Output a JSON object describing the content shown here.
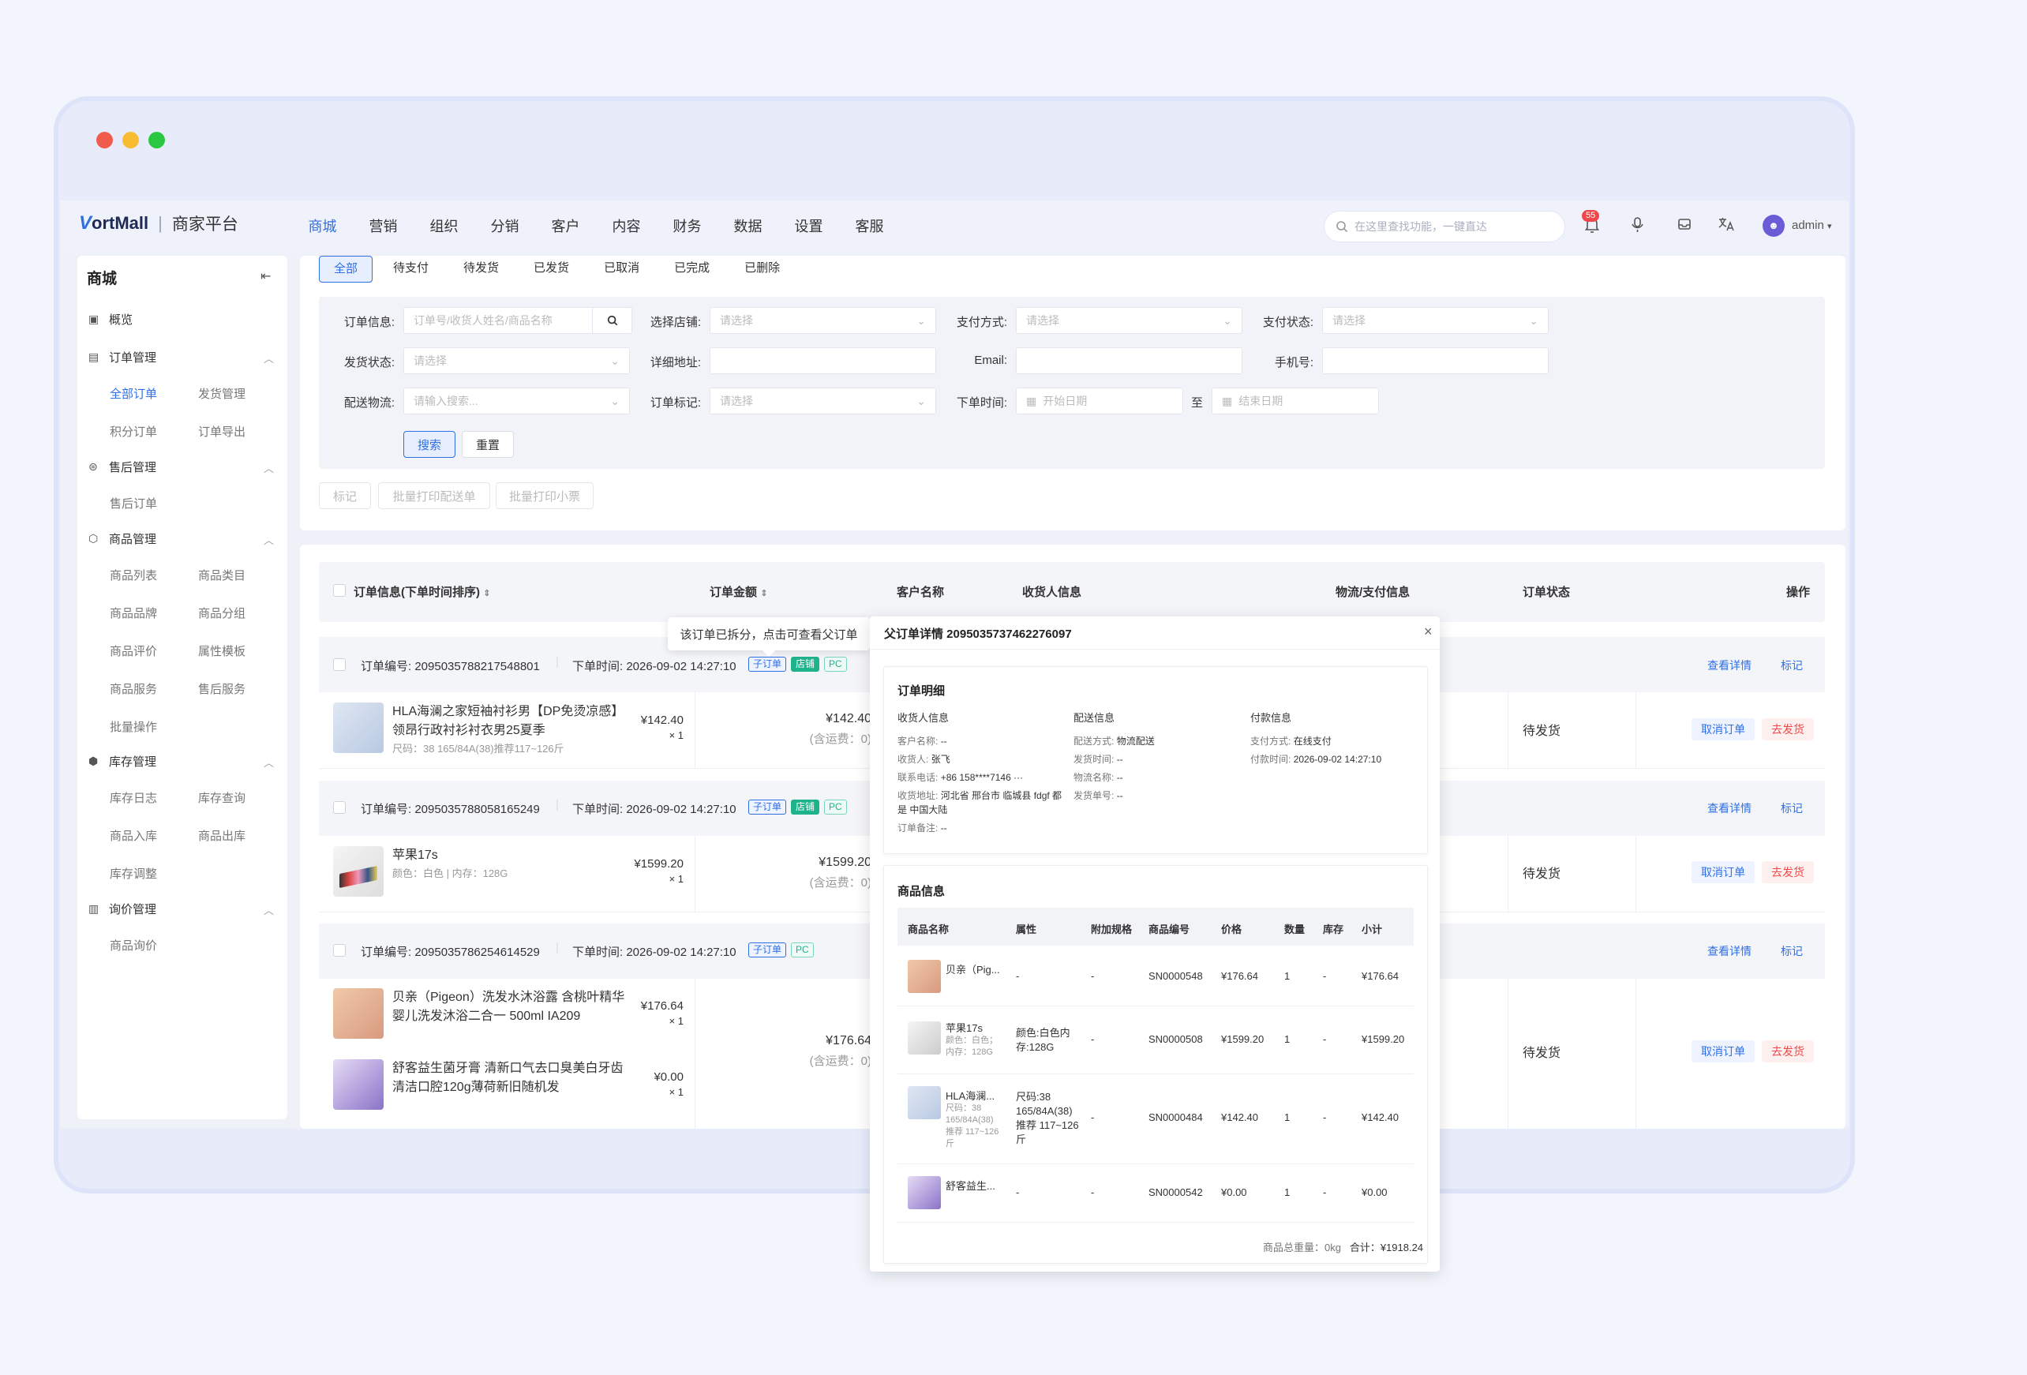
{
  "app": {
    "brand": "ortMall",
    "brand_mark": "V",
    "subtitle": "商家平台"
  },
  "colors": {
    "accent": "#2f6fe4",
    "danger": "#f04848",
    "success": "#1db38b"
  },
  "nav": [
    {
      "label": "商城"
    },
    {
      "label": "营销"
    },
    {
      "label": "组织"
    },
    {
      "label": "分销"
    },
    {
      "label": "客户"
    },
    {
      "label": "内容"
    },
    {
      "label": "财务"
    },
    {
      "label": "数据"
    },
    {
      "label": "设置"
    },
    {
      "label": "客服"
    }
  ],
  "search": {
    "placeholder": "在这里查找功能，一键直达"
  },
  "notifications": {
    "count": "55"
  },
  "user": {
    "name": "admin"
  },
  "sidebar": {
    "title": "商城",
    "overview": "概览",
    "groups": [
      {
        "label": "订单管理",
        "links": [
          "全部订单",
          "发货管理",
          "积分订单",
          "订单导出"
        ]
      },
      {
        "label": "售后管理",
        "links": [
          "售后订单"
        ]
      },
      {
        "label": "商品管理",
        "links": [
          "商品列表",
          "商品类目",
          "商品品牌",
          "商品分组",
          "商品评价",
          "属性模板",
          "商品服务",
          "售后服务",
          "批量操作"
        ]
      },
      {
        "label": "库存管理",
        "links": [
          "库存日志",
          "库存查询",
          "商品入库",
          "商品出库",
          "库存调整"
        ]
      },
      {
        "label": "询价管理",
        "links": [
          "商品询价"
        ]
      }
    ]
  },
  "tabs": [
    "全部",
    "待支付",
    "待发货",
    "已发货",
    "已取消",
    "已完成",
    "已删除"
  ],
  "filters": {
    "order_info": {
      "label": "订单信息:",
      "placeholder": "订单号/收货人姓名/商品名称"
    },
    "shop": {
      "label": "选择店铺:",
      "placeholder": "请选择"
    },
    "pay_method": {
      "label": "支付方式:",
      "placeholder": "请选择"
    },
    "pay_status": {
      "label": "支付状态:",
      "placeholder": "请选择"
    },
    "ship_status": {
      "label": "发货状态:",
      "placeholder": "请选择"
    },
    "address": {
      "label": "详细地址:",
      "placeholder": ""
    },
    "email": {
      "label": "Email:",
      "placeholder": ""
    },
    "phone": {
      "label": "手机号:",
      "placeholder": ""
    },
    "logistics": {
      "label": "配送物流:",
      "placeholder": "请输入搜索..."
    },
    "mark": {
      "label": "订单标记:",
      "placeholder": "请选择"
    },
    "time": {
      "label": "下单时间:",
      "start": "开始日期",
      "to": "至",
      "end": "结束日期"
    },
    "search_btn": "搜索",
    "reset_btn": "重置"
  },
  "bulk": [
    "标记",
    "批量打印配送单",
    "批量打印小票"
  ],
  "table": {
    "headers": {
      "info": "订单信息(下单时间排序)",
      "amount": "订单金额",
      "customer": "客户名称",
      "receiver": "收货人信息",
      "logistics": "物流/支付信息",
      "status": "订单状态",
      "action": "操作"
    }
  },
  "orders": [
    {
      "no_label": "订单编号:",
      "no": "2095035788217548801",
      "time_label": "下单时间:",
      "time": "2026-09-02 14:27:10",
      "tags": [
        "子订单",
        "店铺",
        "PC"
      ],
      "items": [
        {
          "name": "HLA海澜之家短袖衬衫男【DP免烫凉感】领昂行政衬衫衬衣男25夏季",
          "spec": "尺码：38 165/84A(38)推荐117~126斤",
          "price": "¥142.40",
          "qty": "× 1"
        }
      ],
      "total": "¥142.40",
      "freight": "(含运费：0)",
      "status": "待发货",
      "actions": {
        "detail": "查看详情",
        "mark": "标记",
        "cancel": "取消订单",
        "ship": "去发货"
      }
    },
    {
      "no_label": "订单编号:",
      "no": "2095035788058165249",
      "time_label": "下单时间:",
      "time": "2026-09-02 14:27:10",
      "tags": [
        "子订单",
        "店铺",
        "PC"
      ],
      "items": [
        {
          "name": "苹果17s",
          "spec": "颜色：白色 | 内存：128G",
          "price": "¥1599.20",
          "qty": "× 1"
        }
      ],
      "total": "¥1599.20",
      "freight": "(含运费：0)",
      "status": "待发货",
      "actions": {
        "detail": "查看详情",
        "mark": "标记",
        "cancel": "取消订单",
        "ship": "去发货"
      }
    },
    {
      "no_label": "订单编号:",
      "no": "2095035786254614529",
      "time_label": "下单时间:",
      "time": "2026-09-02 14:27:10",
      "tags": [
        "子订单",
        "PC"
      ],
      "items": [
        {
          "name": "贝亲（Pigeon）洗发水沐浴露 含桃叶精华 婴儿洗发沐浴二合一 500ml IA209",
          "spec": "",
          "price": "¥176.64",
          "qty": "× 1"
        },
        {
          "name": "舒客益生菌牙膏 清新口气去口臭美白牙齿清洁口腔120g薄荷新旧随机发",
          "spec": "",
          "price": "¥0.00",
          "qty": "× 1"
        }
      ],
      "total": "¥176.64",
      "freight": "(含运费：0)",
      "status": "待发货",
      "actions": {
        "detail": "查看详情",
        "mark": "标记",
        "cancel": "取消订单",
        "ship": "去发货"
      }
    }
  ],
  "tooltip": "该订单已拆分，点击可查看父订单",
  "popup": {
    "title": "父订单详情 2095035737462276097",
    "detail_title": "订单明细",
    "receiver": {
      "title": "收货人信息",
      "rows": [
        {
          "k": "客户名称:",
          "v": "--"
        },
        {
          "k": "收货人:",
          "v": "张飞"
        },
        {
          "k": "联系电话:",
          "v": "+86  158****7146  ···"
        },
        {
          "k": "收货地址:",
          "v": "河北省 邢台市 临城县 fdgf 都是 中国大陆"
        },
        {
          "k": "订单备注:",
          "v": "--"
        }
      ]
    },
    "delivery": {
      "title": "配送信息",
      "rows": [
        {
          "k": "配送方式:",
          "v": "物流配送"
        },
        {
          "k": "发货时间:",
          "v": "--"
        },
        {
          "k": "物流名称:",
          "v": "--"
        },
        {
          "k": "发货单号:",
          "v": "--"
        }
      ]
    },
    "payment": {
      "title": "付款信息",
      "rows": [
        {
          "k": "支付方式:",
          "v": "在线支付"
        },
        {
          "k": "付款时间:",
          "v": "2026-09-02 14:27:10"
        }
      ]
    },
    "goods_title": "商品信息",
    "goods_headers": [
      "商品名称",
      "属性",
      "附加规格",
      "商品编号",
      "价格",
      "数量",
      "库存",
      "小计"
    ],
    "goods": [
      {
        "name": "贝亲（Pig...",
        "sub": "",
        "attr": "-",
        "extra": "-",
        "sn": "SN0000548",
        "price": "¥176.64",
        "qty": "1",
        "stock": "-",
        "subtotal": "¥176.64"
      },
      {
        "name": "苹果17s",
        "sub": "颜色：白色；内存：128G",
        "attr": "颜色:白色内存:128G",
        "extra": "-",
        "sn": "SN0000508",
        "price": "¥1599.20",
        "qty": "1",
        "stock": "-",
        "subtotal": "¥1599.20"
      },
      {
        "name": "HLA海澜...",
        "sub": "尺码：38 165/84A(38) 推荐 117~126斤",
        "attr": "尺码:38 165/84A(38) 推荐 117~126斤",
        "extra": "-",
        "sn": "SN0000484",
        "price": "¥142.40",
        "qty": "1",
        "stock": "-",
        "subtotal": "¥142.40"
      },
      {
        "name": "舒客益生...",
        "sub": "",
        "attr": "-",
        "extra": "-",
        "sn": "SN0000542",
        "price": "¥0.00",
        "qty": "1",
        "stock": "-",
        "subtotal": "¥0.00"
      }
    ],
    "weight": "商品总重量：0kg",
    "total": "合计：¥1918.24"
  }
}
